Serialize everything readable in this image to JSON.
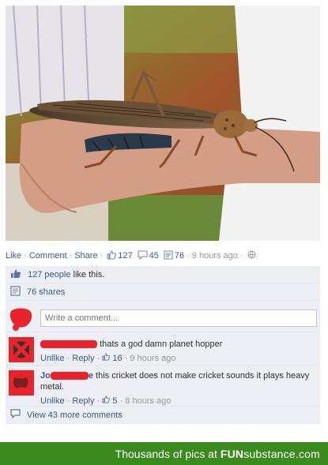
{
  "post": {
    "actions": {
      "like": "Like",
      "comment": "Comment",
      "share": "Share",
      "like_count": "127",
      "comment_count": "45",
      "share_count": "76",
      "time": "9 hours ago"
    }
  },
  "summary": {
    "likes_link": "127 people",
    "likes_suffix": " like this.",
    "shares": "76 shares"
  },
  "write_comment": {
    "placeholder": "Write a comment..."
  },
  "comments": [
    {
      "name_visible": "",
      "text": "thats a god damn planet hopper",
      "unlike": "Unlike",
      "reply": "Reply",
      "likes": "16",
      "time": "9 hours ago"
    },
    {
      "name_visible": "Jo",
      "name_visible_end": "e",
      "text": "this cricket does not make cricket sounds it plays heavy metal.",
      "unlike": "Unlike",
      "reply": "Reply",
      "likes": "5",
      "time": "8 hours ago"
    }
  ],
  "more_comments": "View 43 more comments",
  "footer": {
    "prefix": "Thousands of pics at",
    "brand_bold": "FUN",
    "brand_rest": "substance",
    "brand_tld": ".com"
  },
  "colors": {
    "link": "#3b5998",
    "footer_bg": "#3b8a1d",
    "redaction": "#e8232b"
  }
}
